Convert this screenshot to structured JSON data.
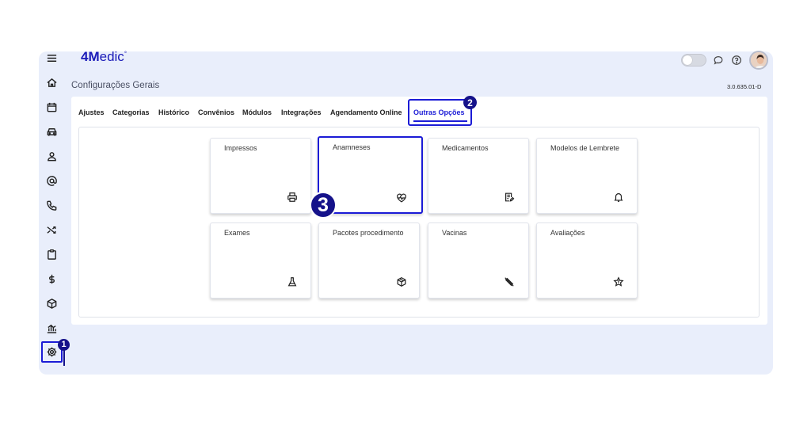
{
  "header": {
    "logo_bold": "4M",
    "logo_rest": "edic",
    "logo_mark": "°",
    "page_title": "Configurações Gerais",
    "version": "3.0.635.01-D"
  },
  "sidebar": {
    "items": [
      {
        "icon": "menu-icon"
      },
      {
        "icon": "home-icon"
      },
      {
        "icon": "calendar-icon"
      },
      {
        "icon": "car-icon"
      },
      {
        "icon": "user-icon"
      },
      {
        "icon": "at-icon"
      },
      {
        "icon": "phone-icon"
      },
      {
        "icon": "shuffle-icon"
      },
      {
        "icon": "clipboard-icon"
      },
      {
        "icon": "dollar-icon"
      },
      {
        "icon": "cube-icon"
      },
      {
        "icon": "chart-icon"
      },
      {
        "icon": "gear-icon",
        "active": true
      }
    ]
  },
  "tabs": [
    {
      "label": "Ajustes"
    },
    {
      "label": "Categorias"
    },
    {
      "label": "Histórico"
    },
    {
      "label": "Convênios"
    },
    {
      "label": "Módulos"
    },
    {
      "label": "Integrações"
    },
    {
      "label": "Agendamento Online"
    },
    {
      "label": "Outras Opções",
      "active": true
    }
  ],
  "cards": [
    {
      "label": "Impressos",
      "icon": "printer-icon"
    },
    {
      "label": "Anamneses",
      "icon": "heart-pulse-icon",
      "highlight": true
    },
    {
      "label": "Medicamentos",
      "icon": "document-edit-icon"
    },
    {
      "label": "Modelos de Lembrete",
      "icon": "bell-icon"
    },
    {
      "label": "Exames",
      "icon": "flask-icon"
    },
    {
      "label": "Pacotes procedimento",
      "icon": "package-icon"
    },
    {
      "label": "Vacinas",
      "icon": "syringe-icon"
    },
    {
      "label": "Avaliações",
      "icon": "star-icon"
    }
  ],
  "markers": {
    "step1": "1",
    "step2": "2",
    "step3": "3"
  },
  "colors": {
    "accent": "#1b1bd6",
    "marker": "#15128a",
    "frame_bg": "#e9eefb"
  }
}
